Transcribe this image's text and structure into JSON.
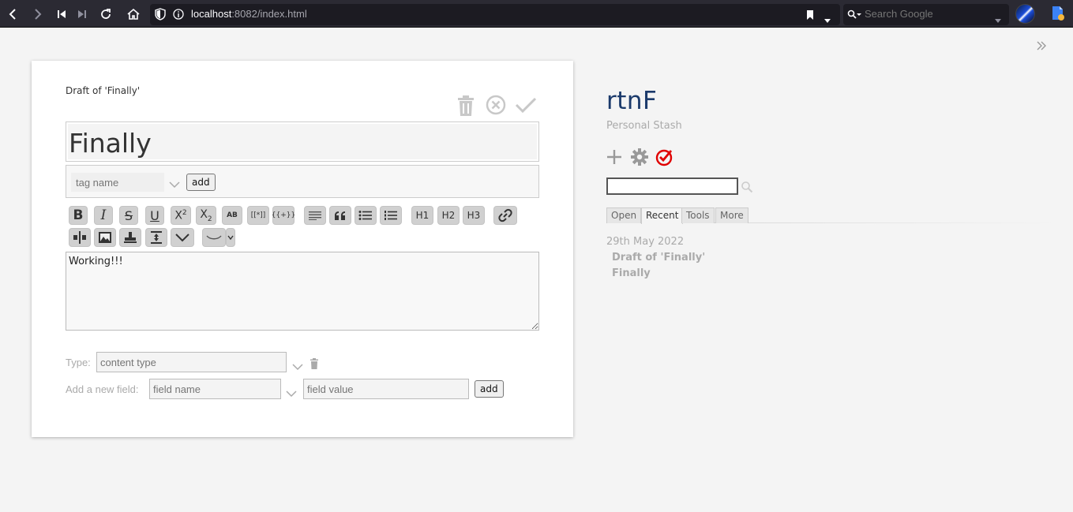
{
  "browser": {
    "url_host": "localhost",
    "url_rest": ":8082/index.html",
    "search_placeholder": "Search Google"
  },
  "editor": {
    "heading": "Draft of 'Finally'",
    "title_value": "Finally",
    "tag_placeholder": "tag name",
    "tag_add_label": "add",
    "toolbar_row1": [
      {
        "name": "bold",
        "text": "B"
      },
      {
        "name": "italic",
        "text": "I"
      },
      {
        "name": "strikethrough",
        "text": "S"
      },
      {
        "name": "underline",
        "text": "U"
      },
      {
        "name": "superscript",
        "text": "X²"
      },
      {
        "name": "subscript",
        "text": "X₂"
      },
      {
        "name": "small-caps",
        "text": "AB"
      },
      {
        "name": "link-ref",
        "text": "[[*]]"
      },
      {
        "name": "template",
        "text": "{{+}}"
      },
      {
        "name": "code-block",
        "text": "ABC"
      },
      {
        "name": "quote",
        "text": "❝"
      },
      {
        "name": "bullet-list",
        "text": "☰"
      },
      {
        "name": "numbered-list",
        "text": "☰"
      },
      {
        "name": "heading-1",
        "text": "H1"
      },
      {
        "name": "heading-2",
        "text": "H2"
      },
      {
        "name": "heading-3",
        "text": "H3"
      },
      {
        "name": "link",
        "text": "🔗"
      }
    ],
    "toolbar_row2": [
      {
        "name": "transclude"
      },
      {
        "name": "image"
      },
      {
        "name": "stamp"
      },
      {
        "name": "excise"
      },
      {
        "name": "more"
      },
      {
        "name": "emoji"
      }
    ],
    "content_value": "Working!!!",
    "type_label": "Type:",
    "type_placeholder": "content type",
    "field_label": "Add a new field:",
    "field_name_placeholder": "field name",
    "field_value_placeholder": "field value",
    "field_add_label": "add"
  },
  "sidebar": {
    "title": "rtnF",
    "subtitle": "Personal Stash",
    "tabs": [
      {
        "label": "Open",
        "active": false
      },
      {
        "label": "Recent",
        "active": true
      },
      {
        "label": "Tools",
        "active": false
      },
      {
        "label": "More",
        "active": false
      }
    ],
    "recent": {
      "date": "29th May 2022",
      "items": [
        "Draft of 'Finally'",
        "Finally"
      ]
    }
  },
  "colors": {
    "chrome_bg": "#2b2a33",
    "page_bg": "#f4f4f4",
    "title_blue": "#1b3a6b",
    "check_red": "#e00000"
  }
}
